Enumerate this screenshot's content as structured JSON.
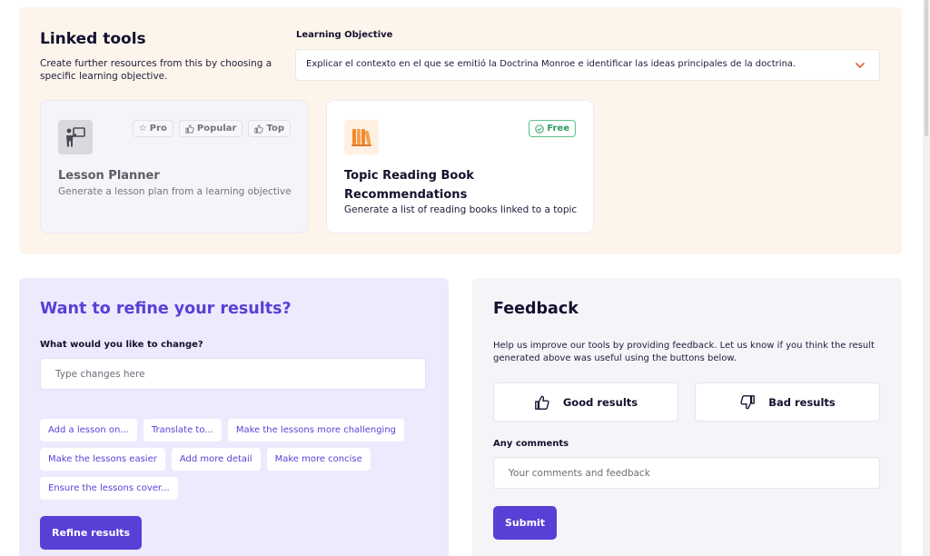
{
  "linked_tools": {
    "title": "Linked tools",
    "description": "Create further resources from this by choosing a specific learning objective.",
    "objective_label": "Learning Objective",
    "objective_value": "Explicar el contexto en el que se emitió la Doctrina Monroe e identificar las ideas principales de la doctrina.",
    "cards": [
      {
        "icon": "teacher-board-icon",
        "badges": [
          "Pro",
          "Popular",
          "Top"
        ],
        "title": "Lesson Planner",
        "description": "Generate a lesson plan from a learning objective"
      },
      {
        "icon": "books-icon",
        "badges": [
          "Free"
        ],
        "title": "Topic Reading Book Recommendations",
        "description": "Generate a list of reading books linked to a topic"
      }
    ]
  },
  "refine": {
    "title": "Want to refine your results?",
    "question": "What would you like to change?",
    "placeholder": "Type changes here",
    "chips": [
      "Add a lesson on...",
      "Translate to...",
      "Make the lessons more challenging",
      "Make the lessons easier",
      "Add more detail",
      "Make more concise",
      "Ensure the lessons cover..."
    ],
    "button": "Refine results"
  },
  "feedback": {
    "title": "Feedback",
    "description": "Help us improve our tools by providing feedback. Let us know if you think the result generated above was useful using the buttons below.",
    "good_label": "Good results",
    "bad_label": "Bad results",
    "comments_label": "Any comments",
    "comments_placeholder": "Your comments and feedback",
    "submit": "Submit"
  },
  "colors": {
    "accent": "#5a3fd6",
    "linked_bg": "#fdf5ec",
    "refine_bg": "#edeafe",
    "feedback_bg": "#f5f4f9",
    "free_badge": "#2f9a64",
    "chevron": "#e06a3c",
    "books_icon": "#f08a2c"
  }
}
